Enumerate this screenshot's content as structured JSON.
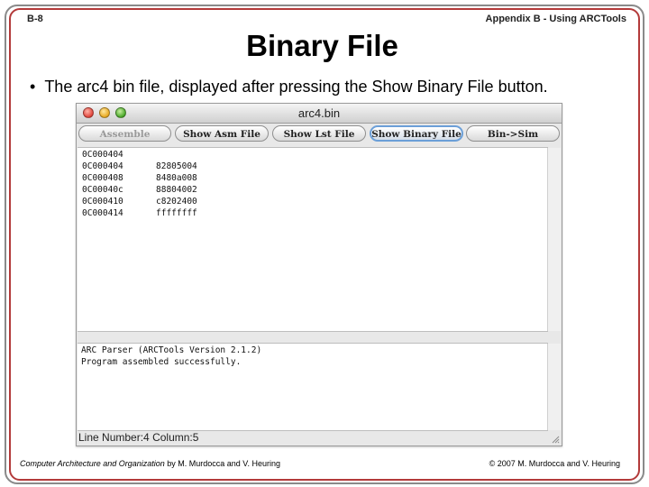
{
  "slide": {
    "number": "B-8",
    "appendix": "Appendix B - Using ARCTools",
    "title": "Binary File",
    "bullet_symbol": "•",
    "bullet": "The arc4 bin file, displayed after pressing the Show Binary File button."
  },
  "window": {
    "title": "arc4.bin",
    "buttons": {
      "assemble": "Assemble",
      "show_asm": "Show Asm File",
      "show_lst": "Show Lst File",
      "show_binary": "Show Binary File",
      "bin_sim": "Bin->Sim"
    },
    "binary_rows": [
      {
        "address": "0C000404",
        "word": ""
      },
      {
        "address": "0C000404",
        "word": "82805004"
      },
      {
        "address": "0C000408",
        "word": "8480a008"
      },
      {
        "address": "0C00040c",
        "word": "88804002"
      },
      {
        "address": "0C000410",
        "word": "c8202400"
      },
      {
        "address": "0C000414",
        "word": "ffffffff"
      }
    ],
    "messages": [
      "ARC Parser (ARCTools Version 2.1.2)",
      "Program assembled successfully."
    ],
    "status": {
      "line_label": "Line Number:",
      "line": "4",
      "column_label": "Column:",
      "column": "5"
    }
  },
  "footer": {
    "book_title": "Computer Architecture and Organization",
    "authors": " by M. Murdocca and V. Heuring",
    "copyright": "© 2007 M. Murdocca and V. Heuring"
  }
}
